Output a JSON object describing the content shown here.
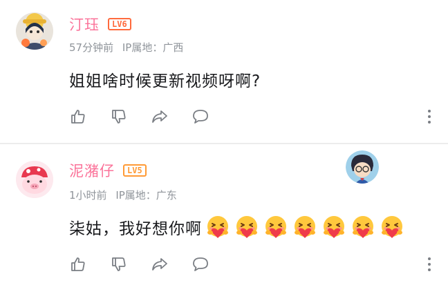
{
  "comments": [
    {
      "username": "汀珏",
      "level": "LV6",
      "time": "57分钟前",
      "ip": "IP属地：广西",
      "text": "姐姐啥时候更新视频呀啊?"
    },
    {
      "username": "泥潴仔",
      "level": "LV5",
      "time": "1小时前",
      "ip": "IP属地：广东",
      "text": "柒姑，我好想你啊",
      "emoji_count": 7,
      "emoji_icon": "hug-heart-emoji"
    }
  ],
  "icons": [
    "thumbs-up-icon",
    "thumbs-down-icon",
    "share-icon",
    "reply-icon",
    "more-icon"
  ],
  "colors": {
    "username": "#fb7299",
    "level6": "#ff6a3d",
    "level5": "#ff9a35",
    "meta": "#8f949a",
    "icon": "#7a7e84"
  }
}
